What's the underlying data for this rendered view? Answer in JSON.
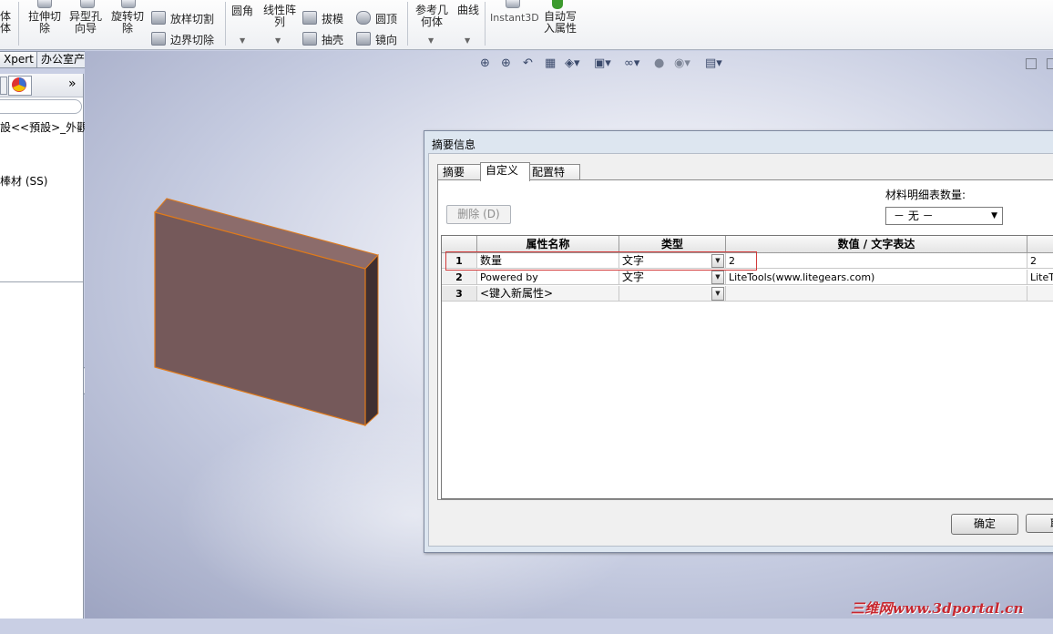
{
  "ribbon": {
    "big_buttons": [
      {
        "label": "体\n体"
      },
      {
        "label": "拉伸切\n除"
      },
      {
        "label": "异型孔\n向导"
      },
      {
        "label": "旋转切\n除"
      },
      {
        "label": "圆角"
      },
      {
        "label": "线性阵\n列"
      },
      {
        "label": "参考几\n何体"
      },
      {
        "label": "曲线"
      },
      {
        "label": "Instant3D"
      },
      {
        "label": "自动写\n入属性"
      }
    ],
    "small_buttons": [
      {
        "label": "放样切割"
      },
      {
        "label": "边界切除"
      },
      {
        "label": "拔模"
      },
      {
        "label": "抽壳"
      },
      {
        "label": "圆顶"
      },
      {
        "label": "镜向"
      }
    ]
  },
  "command_tabs": [
    "Xpert",
    "办公室产品"
  ],
  "left_pane": {
    "collapse_label": "»",
    "tree_items": [
      "設<<預設>_外觀",
      "棒材 (SS)"
    ]
  },
  "dialog": {
    "title": "摘要信息",
    "tabs": [
      "摘要",
      "自定义",
      "配置特定"
    ],
    "active_tab": "自定义",
    "delete_button": "删除 (D)",
    "qty_label": "材料明细表数量:",
    "qty_value": "－ 无 －",
    "grid": {
      "headers": [
        "属性名称",
        "类型",
        "数值 / 文字表达",
        ""
      ],
      "rows": [
        {
          "num": "1",
          "name": "数量",
          "type": "文字",
          "value": "2",
          "evaluated": "2"
        },
        {
          "num": "2",
          "name": "Powered by",
          "type": "文字",
          "value": "LiteTools(www.litegears.com)",
          "evaluated": "LiteTo"
        },
        {
          "num": "3",
          "name": "<键入新属性>",
          "type": "",
          "value": "",
          "evaluated": ""
        }
      ]
    },
    "ok_button": "确定",
    "cancel_button": "取"
  },
  "watermark": "三维网www.3dportal.cn",
  "colors": {
    "part_face": "#75595a",
    "part_edge": "#e07a1a",
    "highlight": "#d23a3a"
  }
}
